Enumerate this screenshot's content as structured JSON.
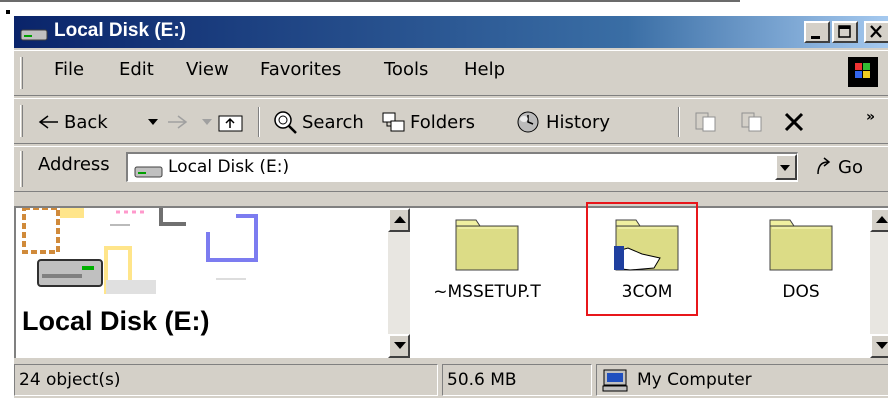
{
  "window": {
    "title": "Local Disk (E:)"
  },
  "menu": [
    "File",
    "Edit",
    "View",
    "Favorites",
    "Tools",
    "Help"
  ],
  "toolbar": {
    "back": "Back",
    "search": "Search",
    "folders": "Folders",
    "history": "History",
    "icons": [
      "back-arrow-icon",
      "forward-arrow-icon",
      "up-folder-icon",
      "search-icon",
      "folders-icon",
      "history-icon",
      "move-to-icon",
      "copy-to-icon",
      "delete-icon"
    ]
  },
  "address": {
    "label": "Address",
    "value": "Local Disk (E:)",
    "go": "Go"
  },
  "left_pane": {
    "title": "Local Disk (E:)"
  },
  "files": [
    {
      "name": "~MSSETUP.T",
      "type": "folder"
    },
    {
      "name": "3COM",
      "type": "shared-folder",
      "highlighted": true
    },
    {
      "name": "DOS",
      "type": "folder"
    }
  ],
  "status": {
    "objects": "24 object(s)",
    "size": "50.6 MB",
    "zone": "My Computer"
  },
  "colors": {
    "highlight": "#e8161b",
    "titlebar": "#0a246a",
    "folder": "#dcdc86"
  }
}
